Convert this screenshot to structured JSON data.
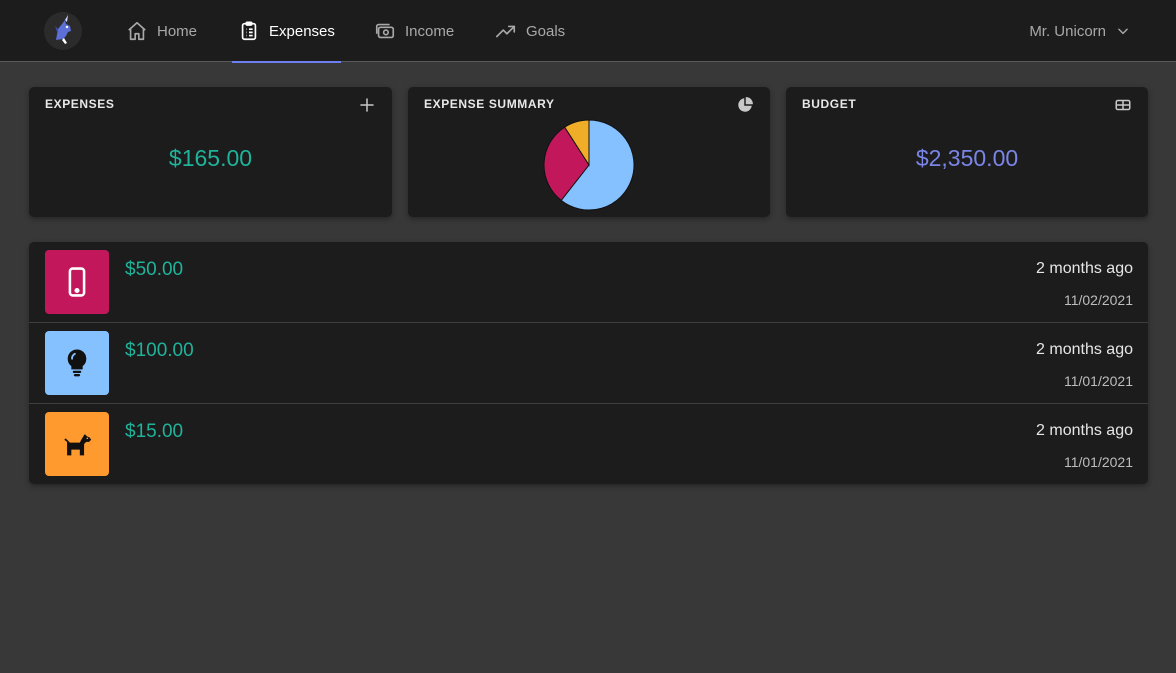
{
  "nav": {
    "items": [
      {
        "label": "Home",
        "icon": "home-icon",
        "active": false
      },
      {
        "label": "Expenses",
        "icon": "clipboard-list-icon",
        "active": true
      },
      {
        "label": "Income",
        "icon": "cash-icon",
        "active": false
      },
      {
        "label": "Goals",
        "icon": "trending-up-icon",
        "active": false
      }
    ],
    "user": "Mr. Unicorn",
    "accent_color": "#6d7ef0"
  },
  "cards": {
    "expenses": {
      "title": "EXPENSES",
      "value": "$165.00",
      "icon": "plus-icon",
      "value_color": "#1fb39a"
    },
    "summary": {
      "title": "EXPENSE SUMMARY",
      "icon": "pie-chart-icon"
    },
    "budget": {
      "title": "BUDGET",
      "value": "$2,350.00",
      "icon": "table-icon",
      "value_color": "#7b85e8"
    }
  },
  "chart_data": {
    "type": "pie",
    "values": [
      100,
      50,
      15
    ],
    "colors": [
      "#85c1ff",
      "#c2185b",
      "#f0ad28"
    ]
  },
  "expenses": [
    {
      "amount": "$50.00",
      "relative": "2 months ago",
      "date": "11/02/2021",
      "icon": "mobile-phone-icon",
      "color": "#c2185b"
    },
    {
      "amount": "$100.00",
      "relative": "2 months ago",
      "date": "11/01/2021",
      "icon": "lightbulb-icon",
      "color": "#85c1ff"
    },
    {
      "amount": "$15.00",
      "relative": "2 months ago",
      "date": "11/01/2021",
      "icon": "dog-icon",
      "color": "#ff9a2e"
    }
  ]
}
